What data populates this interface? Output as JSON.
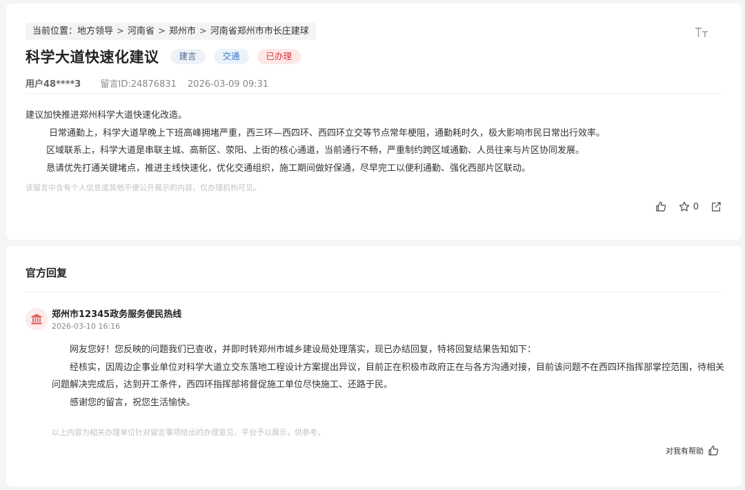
{
  "breadcrumb": {
    "items": [
      "当前位置：地方领导",
      "河南省",
      "郑州市",
      "河南省郑州市市长庄建球"
    ],
    "separator": ">"
  },
  "post": {
    "title": "科学大道快速化建议",
    "tags": [
      "建言",
      "交通",
      "已办理"
    ],
    "user": "用户48****3",
    "message_id": "留言ID:24876831",
    "datetime": "2026-03-09 09:31",
    "paragraphs": [
      "建议加快推进郑州科学大道快速化改造。",
      "日常通勤上，科学大道早晚上下班高峰拥堵严重，西三环—西四环、西四环立交等节点常年梗阻，通勤耗时久，极大影响市民日常出行效率。",
      "区域联系上，科学大道是串联主城、高新区、荥阳、上街的核心通道，当前通行不畅，严重制约跨区域通勤、人员往来与片区协同发展。",
      "恳请优先打通关键堵点，推进主线快速化，优化交通组织，施工期间做好保通，尽早完工以便利通勤、强化西部片区联动。"
    ],
    "notice": "该留言中含有个人信息或其他不便公开展示的内容，仅办理机构可见。",
    "favorite_count": "0"
  },
  "reply": {
    "section_title": "官方回复",
    "org_name": "郑州市12345政务服务便民热线",
    "datetime": "2026-03-10 16:16",
    "paragraphs": [
      "网友您好！您反映的问题我们已查收，并即时转郑州市城乡建设局处理落实，现已办结回复，特将回复结果告知如下：",
      "经核实，因周边企事业单位对科学大道立交东落地工程设计方案提出异议，目前正在积极市政府正在与各方沟通对接，目前该问题不在西四环指挥部掌控范围，待相关问题解决完成后，达到开工条件，西四环指挥部将督促施工单位尽快施工、还路于民。",
      "感谢您的留言，祝您生活愉快。"
    ],
    "notice": "以上内容为相关办理单位针对留言事项给出的办理意见，平台予以展示，供参考。",
    "helpful_label": "对我有帮助"
  },
  "icons": {
    "font_size": "font-size-icon",
    "like": "thumbs-up-icon",
    "favorite": "star-icon",
    "share": "share-icon",
    "org": "government-building-icon"
  },
  "colors": {
    "accent_red": "#d9363e",
    "accent_blue": "#3a79c9"
  }
}
